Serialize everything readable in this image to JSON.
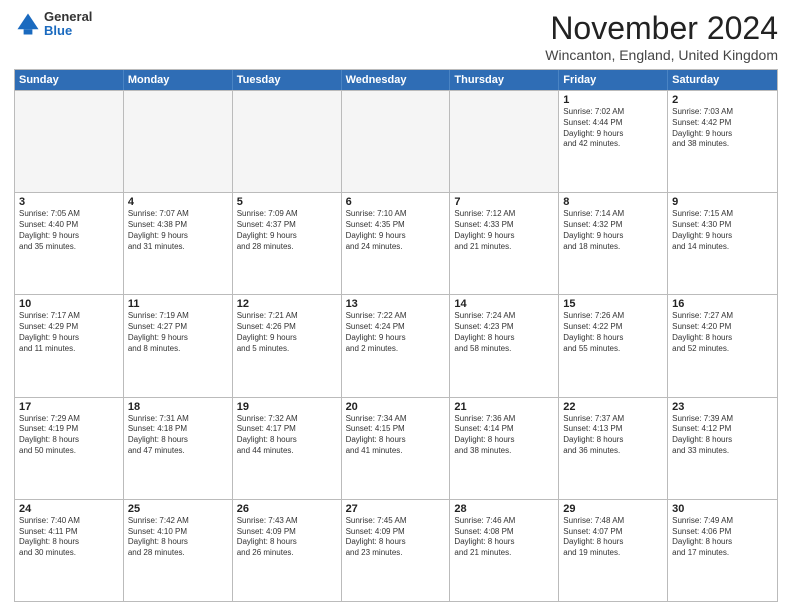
{
  "logo": {
    "general": "General",
    "blue": "Blue"
  },
  "title": "November 2024",
  "location": "Wincanton, England, United Kingdom",
  "header_days": [
    "Sunday",
    "Monday",
    "Tuesday",
    "Wednesday",
    "Thursday",
    "Friday",
    "Saturday"
  ],
  "rows": [
    [
      {
        "day": "",
        "info": "",
        "empty": true
      },
      {
        "day": "",
        "info": "",
        "empty": true
      },
      {
        "day": "",
        "info": "",
        "empty": true
      },
      {
        "day": "",
        "info": "",
        "empty": true
      },
      {
        "day": "",
        "info": "",
        "empty": true
      },
      {
        "day": "1",
        "info": "Sunrise: 7:02 AM\nSunset: 4:44 PM\nDaylight: 9 hours\nand 42 minutes."
      },
      {
        "day": "2",
        "info": "Sunrise: 7:03 AM\nSunset: 4:42 PM\nDaylight: 9 hours\nand 38 minutes."
      }
    ],
    [
      {
        "day": "3",
        "info": "Sunrise: 7:05 AM\nSunset: 4:40 PM\nDaylight: 9 hours\nand 35 minutes."
      },
      {
        "day": "4",
        "info": "Sunrise: 7:07 AM\nSunset: 4:38 PM\nDaylight: 9 hours\nand 31 minutes."
      },
      {
        "day": "5",
        "info": "Sunrise: 7:09 AM\nSunset: 4:37 PM\nDaylight: 9 hours\nand 28 minutes."
      },
      {
        "day": "6",
        "info": "Sunrise: 7:10 AM\nSunset: 4:35 PM\nDaylight: 9 hours\nand 24 minutes."
      },
      {
        "day": "7",
        "info": "Sunrise: 7:12 AM\nSunset: 4:33 PM\nDaylight: 9 hours\nand 21 minutes."
      },
      {
        "day": "8",
        "info": "Sunrise: 7:14 AM\nSunset: 4:32 PM\nDaylight: 9 hours\nand 18 minutes."
      },
      {
        "day": "9",
        "info": "Sunrise: 7:15 AM\nSunset: 4:30 PM\nDaylight: 9 hours\nand 14 minutes."
      }
    ],
    [
      {
        "day": "10",
        "info": "Sunrise: 7:17 AM\nSunset: 4:29 PM\nDaylight: 9 hours\nand 11 minutes."
      },
      {
        "day": "11",
        "info": "Sunrise: 7:19 AM\nSunset: 4:27 PM\nDaylight: 9 hours\nand 8 minutes."
      },
      {
        "day": "12",
        "info": "Sunrise: 7:21 AM\nSunset: 4:26 PM\nDaylight: 9 hours\nand 5 minutes."
      },
      {
        "day": "13",
        "info": "Sunrise: 7:22 AM\nSunset: 4:24 PM\nDaylight: 9 hours\nand 2 minutes."
      },
      {
        "day": "14",
        "info": "Sunrise: 7:24 AM\nSunset: 4:23 PM\nDaylight: 8 hours\nand 58 minutes."
      },
      {
        "day": "15",
        "info": "Sunrise: 7:26 AM\nSunset: 4:22 PM\nDaylight: 8 hours\nand 55 minutes."
      },
      {
        "day": "16",
        "info": "Sunrise: 7:27 AM\nSunset: 4:20 PM\nDaylight: 8 hours\nand 52 minutes."
      }
    ],
    [
      {
        "day": "17",
        "info": "Sunrise: 7:29 AM\nSunset: 4:19 PM\nDaylight: 8 hours\nand 50 minutes."
      },
      {
        "day": "18",
        "info": "Sunrise: 7:31 AM\nSunset: 4:18 PM\nDaylight: 8 hours\nand 47 minutes."
      },
      {
        "day": "19",
        "info": "Sunrise: 7:32 AM\nSunset: 4:17 PM\nDaylight: 8 hours\nand 44 minutes."
      },
      {
        "day": "20",
        "info": "Sunrise: 7:34 AM\nSunset: 4:15 PM\nDaylight: 8 hours\nand 41 minutes."
      },
      {
        "day": "21",
        "info": "Sunrise: 7:36 AM\nSunset: 4:14 PM\nDaylight: 8 hours\nand 38 minutes."
      },
      {
        "day": "22",
        "info": "Sunrise: 7:37 AM\nSunset: 4:13 PM\nDaylight: 8 hours\nand 36 minutes."
      },
      {
        "day": "23",
        "info": "Sunrise: 7:39 AM\nSunset: 4:12 PM\nDaylight: 8 hours\nand 33 minutes."
      }
    ],
    [
      {
        "day": "24",
        "info": "Sunrise: 7:40 AM\nSunset: 4:11 PM\nDaylight: 8 hours\nand 30 minutes."
      },
      {
        "day": "25",
        "info": "Sunrise: 7:42 AM\nSunset: 4:10 PM\nDaylight: 8 hours\nand 28 minutes."
      },
      {
        "day": "26",
        "info": "Sunrise: 7:43 AM\nSunset: 4:09 PM\nDaylight: 8 hours\nand 26 minutes."
      },
      {
        "day": "27",
        "info": "Sunrise: 7:45 AM\nSunset: 4:09 PM\nDaylight: 8 hours\nand 23 minutes."
      },
      {
        "day": "28",
        "info": "Sunrise: 7:46 AM\nSunset: 4:08 PM\nDaylight: 8 hours\nand 21 minutes."
      },
      {
        "day": "29",
        "info": "Sunrise: 7:48 AM\nSunset: 4:07 PM\nDaylight: 8 hours\nand 19 minutes."
      },
      {
        "day": "30",
        "info": "Sunrise: 7:49 AM\nSunset: 4:06 PM\nDaylight: 8 hours\nand 17 minutes."
      }
    ]
  ]
}
